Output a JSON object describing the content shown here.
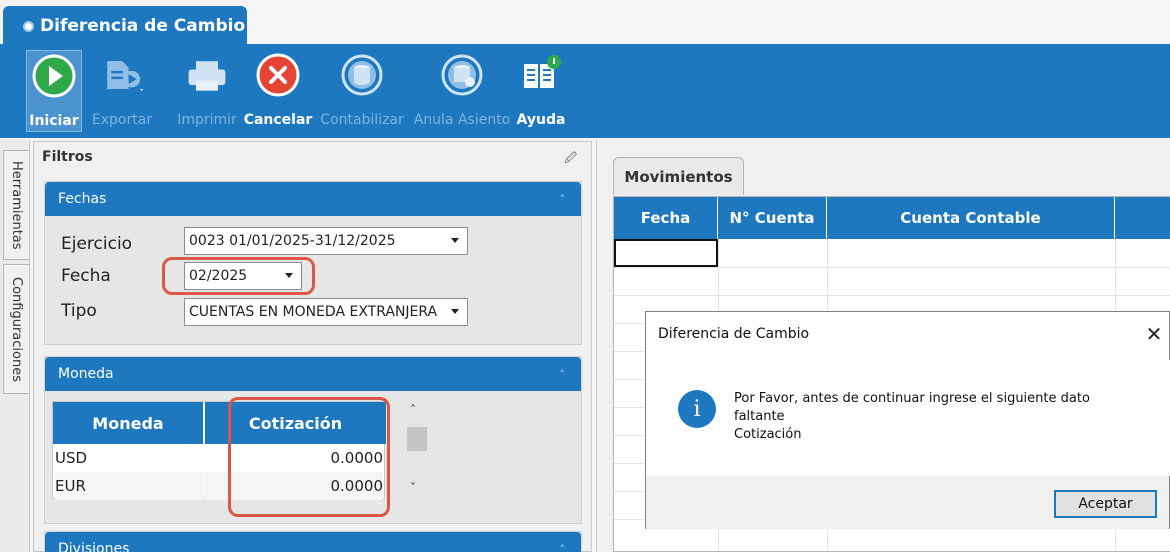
{
  "window": {
    "tab_title": "Diferencia de Cambio"
  },
  "ribbon": {
    "buttons": [
      {
        "label": "Iniciar",
        "icon": "play-icon",
        "state": "active"
      },
      {
        "label": "Exportar",
        "icon": "export-icon",
        "state": "disabled"
      },
      {
        "label": "Imprimir",
        "icon": "printer-icon",
        "state": "disabled"
      },
      {
        "label": "Cancelar",
        "icon": "cancel-icon",
        "state": "enabled"
      },
      {
        "label": "Contabilizar",
        "icon": "database-icon",
        "state": "disabled"
      },
      {
        "label": "Anula Asiento",
        "icon": "database-cancel-icon",
        "state": "disabled"
      },
      {
        "label": "Ayuda",
        "icon": "help-book-icon",
        "state": "enabled"
      }
    ]
  },
  "side_tabs": {
    "herramientas": "Herramientas",
    "configuraciones": "Configuraciones"
  },
  "filters": {
    "title": "Filtros",
    "fechas": {
      "header": "Fechas",
      "ejercicio_label": "Ejercicio",
      "ejercicio_value": "0023 01/01/2025-31/12/2025",
      "fecha_label": "Fecha",
      "fecha_value": "02/2025",
      "tipo_label": "Tipo",
      "tipo_value": "CUENTAS EN MONEDA EXTRANJERA"
    },
    "moneda": {
      "header": "Moneda",
      "columns": [
        "Moneda",
        "Cotización"
      ],
      "rows": [
        {
          "moneda": "USD",
          "cotizacion": "0.0000"
        },
        {
          "moneda": "EUR",
          "cotizacion": "0.0000"
        }
      ]
    },
    "divisiones": {
      "header": "Divisiones"
    }
  },
  "movimientos": {
    "tab_label": "Movimientos",
    "columns": [
      "Fecha",
      "N° Cuenta",
      "Cuenta Contable"
    ]
  },
  "dialog": {
    "title": "Diferencia de Cambio",
    "close": "✕",
    "info_glyph": "i",
    "message_line1": "Por Favor, antes de continuar ingrese el siguiente dato",
    "message_line2": "faltante",
    "message_line3": "Cotización",
    "ok_label": "Aceptar"
  },
  "colors": {
    "accent": "#1d78bf",
    "highlight": "#d9584a"
  }
}
